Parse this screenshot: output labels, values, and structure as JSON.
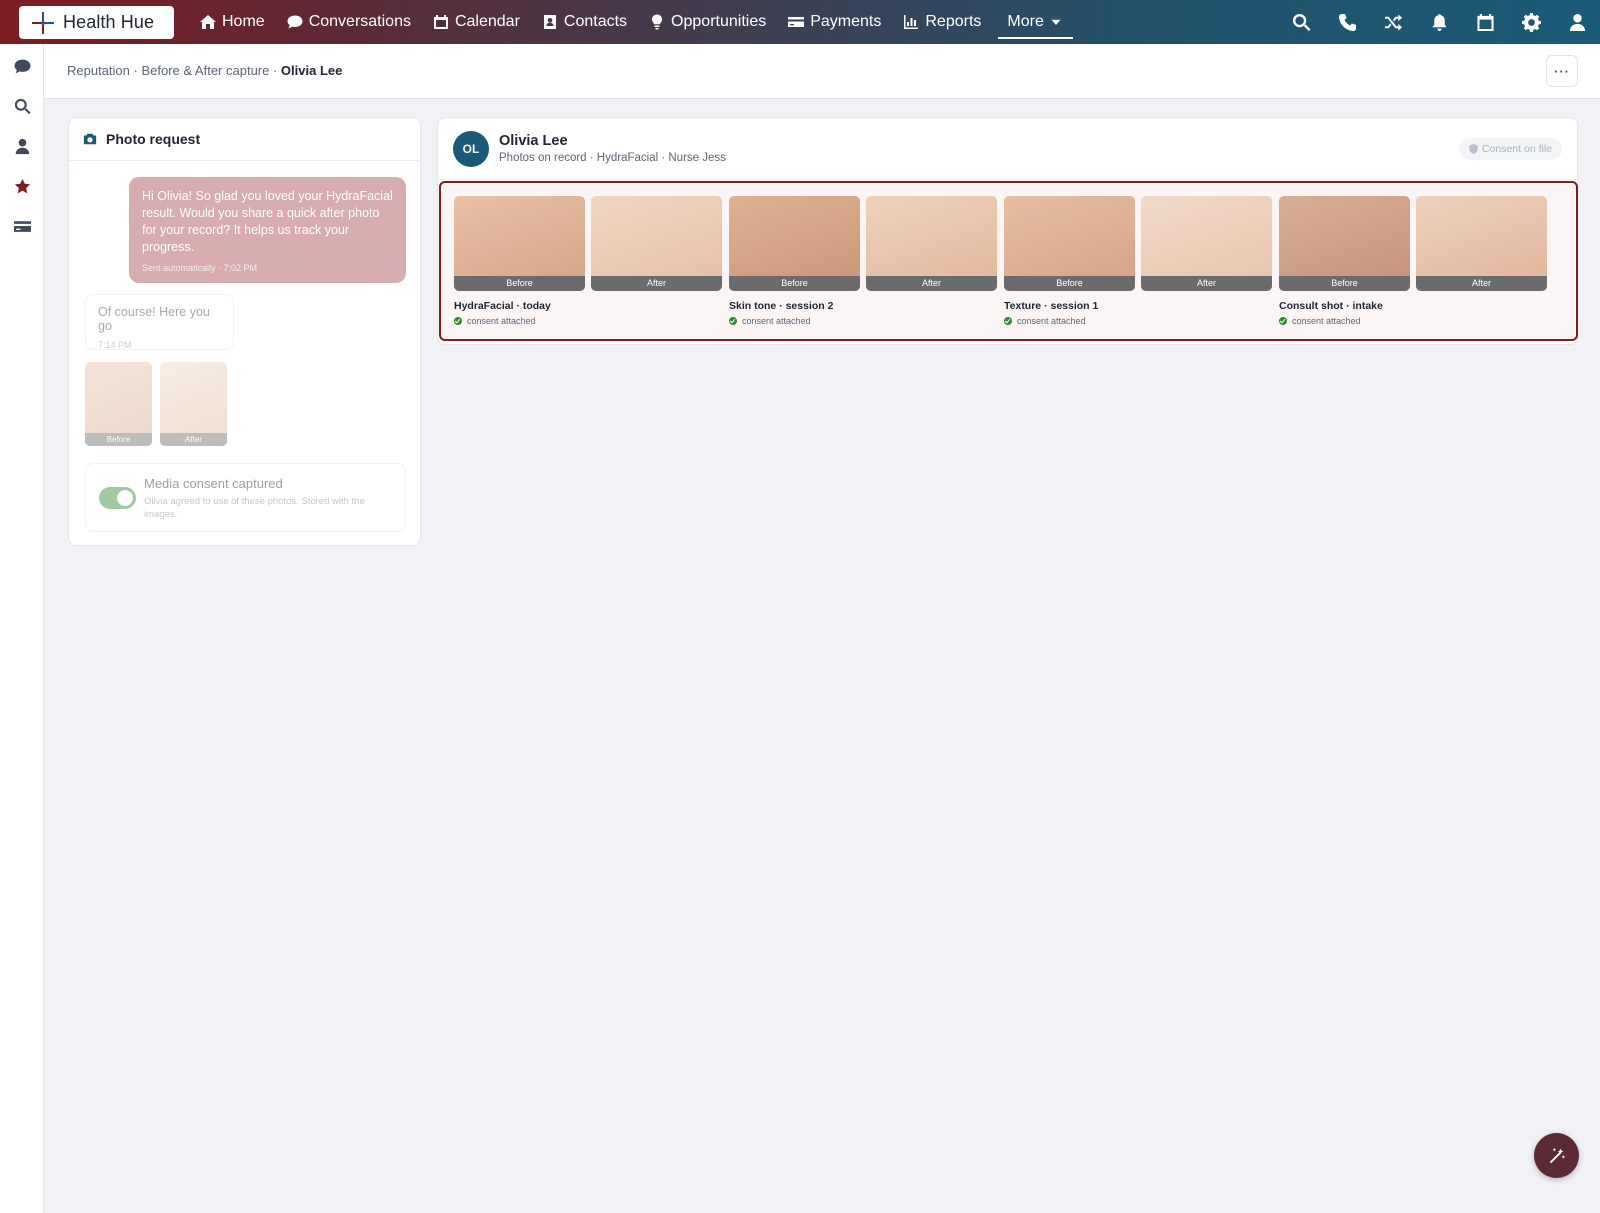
{
  "brand": {
    "name": "Health Hue"
  },
  "nav": {
    "items": [
      {
        "label": "Home",
        "icon": "home-icon"
      },
      {
        "label": "Conversations",
        "icon": "chat-icon"
      },
      {
        "label": "Calendar",
        "icon": "calendar-icon"
      },
      {
        "label": "Contacts",
        "icon": "contact-card-icon"
      },
      {
        "label": "Opportunities",
        "icon": "lightbulb-icon"
      },
      {
        "label": "Payments",
        "icon": "credit-card-icon"
      },
      {
        "label": "Reports",
        "icon": "bar-chart-icon"
      }
    ],
    "more_label": "More",
    "right_icons": [
      "search-icon",
      "phone-icon",
      "shuffle-icon",
      "bell-icon",
      "calendar-icon",
      "gear-icon",
      "user-icon"
    ]
  },
  "rail": {
    "icons": [
      "chat-icon",
      "search-icon",
      "user-icon",
      "star-icon",
      "credit-card-icon"
    ],
    "active": "star-icon"
  },
  "breadcrumb": {
    "parts": [
      "Reputation",
      "Before & After capture"
    ],
    "current": "Olivia Lee",
    "separator": " · "
  },
  "more_menu": "···",
  "photo_request": {
    "title": "Photo request",
    "outgoing": {
      "text": "Hi Olivia! So glad you loved your HydraFacial result. Would you share a quick after photo for your record? It helps us track your progress.",
      "meta": "Sent automatically · 7:02 PM"
    },
    "incoming": {
      "text": "Of course! Here you go",
      "meta": "7:14 PM"
    },
    "mini_photos": [
      {
        "label": "Before"
      },
      {
        "label": "After"
      }
    ],
    "consent": {
      "title": "Media consent captured",
      "subtitle": "Olivia agreed to use of these photos. Stored with the images.",
      "enabled": true
    }
  },
  "record": {
    "initials": "OL",
    "name": "Olivia Lee",
    "subtitle": "Photos on record · HydraFacial · Nurse Jess",
    "consent_pill": "Consent on file",
    "groups": [
      {
        "title": "HydraFacial · today",
        "consent": "consent attached",
        "before": "Before",
        "after": "After"
      },
      {
        "title": "Skin tone · session 2",
        "consent": "consent attached",
        "before": "Before",
        "after": "After"
      },
      {
        "title": "Texture · session 1",
        "consent": "consent attached",
        "before": "Before",
        "after": "After"
      },
      {
        "title": "Consult shot · intake",
        "consent": "consent attached",
        "before": "Before",
        "after": "After"
      }
    ]
  },
  "colors": {
    "brand_red": "#7d1d22",
    "brand_teal": "#1b5a76",
    "success": "#2f8a2f"
  }
}
